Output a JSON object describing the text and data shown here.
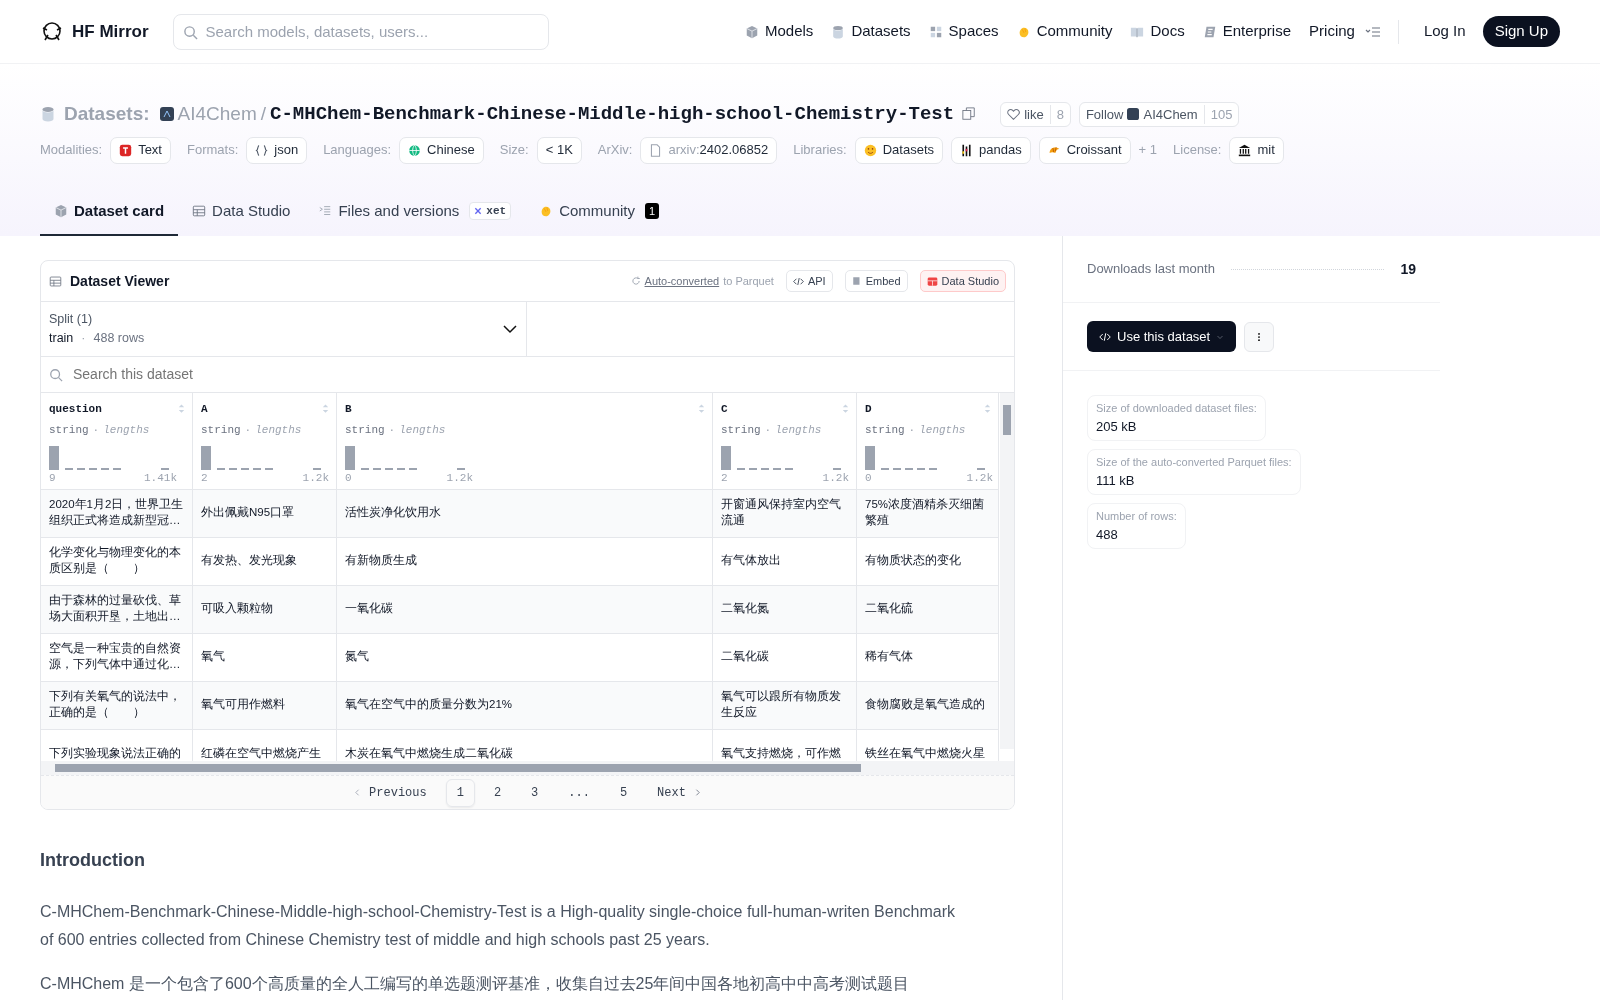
{
  "navbar": {
    "logo": "HF Mirror",
    "search_placeholder": "Search models, datasets, users...",
    "links": [
      {
        "label": "Models"
      },
      {
        "label": "Datasets"
      },
      {
        "label": "Spaces"
      },
      {
        "label": "Community"
      },
      {
        "label": "Docs"
      },
      {
        "label": "Enterprise"
      },
      {
        "label": "Pricing"
      }
    ],
    "login": "Log In",
    "signup": "Sign Up"
  },
  "header": {
    "section": "Datasets:",
    "org": "AI4Chem",
    "separator": "/",
    "name": "C-MHChem-Benchmark-Chinese-Middle-high-school-Chemistry-Test",
    "like": "like",
    "likes": "8",
    "follow": "Follow",
    "follow_org": "AI4Chem",
    "followers": "105"
  },
  "tags": [
    {
      "label": "Modalities:",
      "chips": [
        {
          "text": "Text"
        }
      ]
    },
    {
      "label": "Formats:",
      "chips": [
        {
          "text": "json"
        }
      ]
    },
    {
      "label": "Languages:",
      "chips": [
        {
          "text": "Chinese"
        }
      ]
    },
    {
      "label": "Size:",
      "chips": [
        {
          "text": "< 1K"
        }
      ]
    },
    {
      "label": "ArXiv:",
      "chips": [
        {
          "prefix": "arxiv:",
          "text": "2402.06852"
        }
      ]
    },
    {
      "label": "Libraries:",
      "chips": [
        {
          "text": "Datasets"
        },
        {
          "text": "pandas"
        },
        {
          "text": "Croissant"
        }
      ],
      "more": "+ 1"
    },
    {
      "label": "License:",
      "chips": [
        {
          "text": "mit"
        }
      ]
    }
  ],
  "tabs": [
    {
      "label": "Dataset card",
      "selected": true
    },
    {
      "label": "Data Studio",
      "selected": false
    },
    {
      "label": "Files and versions",
      "selected": false,
      "tag": "xet"
    },
    {
      "label": "Community",
      "selected": false,
      "count": "1"
    }
  ],
  "viewer": {
    "title": "Dataset Viewer",
    "auto_link": "Auto-converted",
    "auto_rest": "to Parquet",
    "buttons": [
      {
        "label": "API",
        "kind": "code"
      },
      {
        "label": "Embed",
        "kind": "embed"
      },
      {
        "label": "Data Studio",
        "kind": "studio"
      }
    ],
    "split_label": "Split (1)",
    "split": "train",
    "split_separator": "·",
    "split_rows": "488 rows",
    "search_placeholder": "Search this dataset",
    "columns": [
      {
        "name": "question",
        "type": "string",
        "separator": "·",
        "stat": "lengths",
        "min": "9",
        "max": "1.41k"
      },
      {
        "name": "A",
        "type": "string",
        "separator": "·",
        "stat": "lengths",
        "min": "2",
        "max": "1.2k"
      },
      {
        "name": "B",
        "type": "string",
        "separator": "·",
        "stat": "lengths",
        "min": "0",
        "max": "1.2k"
      },
      {
        "name": "C",
        "type": "string",
        "separator": "·",
        "stat": "lengths",
        "min": "2",
        "max": "1.2k"
      },
      {
        "name": "D",
        "type": "string",
        "separator": "·",
        "stat": "lengths",
        "min": "0",
        "max": "1.2k"
      }
    ],
    "rows": [
      [
        "2020年1月2日，世界卫生组织正式将造成新型冠…",
        "外出佩戴N95口罩",
        "活性炭净化饮用水",
        "开窗通风保持室内空气流通",
        "75%浓度酒精杀灭细菌繁殖"
      ],
      [
        "化学变化与物理变化的本质区别是（　　）",
        "有发热、发光现象",
        "有新物质生成",
        "有气体放出",
        "有物质状态的变化"
      ],
      [
        "由于森林的过量砍伐、草场大面积开垦，土地出…",
        "可吸入颗粒物",
        "一氧化碳",
        "二氧化氮",
        "二氧化硫"
      ],
      [
        "空气是一种宝贵的自然资源，下列气体中通过化…",
        "氧气",
        "氮气",
        "二氧化碳",
        "稀有气体"
      ],
      [
        "下列有关氧气的说法中，正确的是（　　）",
        "氧气可用作燃料",
        "氧气在空气中的质量分数为21%",
        "氧气可以跟所有物质发生反应",
        "食物腐败是氧气造成的"
      ],
      [
        "下列实验现象说法正确的",
        "红磷在空气中燃烧产生",
        "木炭在氧气中燃烧生成二氧化碳",
        "氧气支持燃烧，可作燃",
        "铁丝在氧气中燃烧火星"
      ]
    ],
    "pagination": {
      "previous": "Previous",
      "pages": [
        {
          "label": "1",
          "selected": true
        },
        {
          "label": "2",
          "selected": false
        },
        {
          "label": "3",
          "selected": false
        },
        {
          "label": "...",
          "selected": false
        },
        {
          "label": "5",
          "selected": false
        }
      ],
      "next": "Next"
    }
  },
  "sidebar": {
    "downloads_label": "Downloads last month",
    "downloads": "19",
    "use_button": "Use this dataset",
    "stats": [
      {
        "label": "Size of downloaded dataset files:",
        "value": "205 kB"
      },
      {
        "label": "Size of the auto-converted Parquet files:",
        "value": "111 kB"
      },
      {
        "label": "Number of rows:",
        "value": "488"
      }
    ]
  },
  "card": {
    "heading": "Introduction",
    "paragraphs": [
      "C-MHChem-Benchmark-Chinese-Middle-high-school-Chemistry-Test is a High-quality single-choice full-human-writen Benchmark of 600 entries collected from Chinese Chemistry test of middle and high schools past 25 years.",
      "C-MHChem 是一个包含了600个高质量的全人工编写的单选题测评基准，收集自过去25年间中国各地初高中中高考测试题目"
    ]
  }
}
